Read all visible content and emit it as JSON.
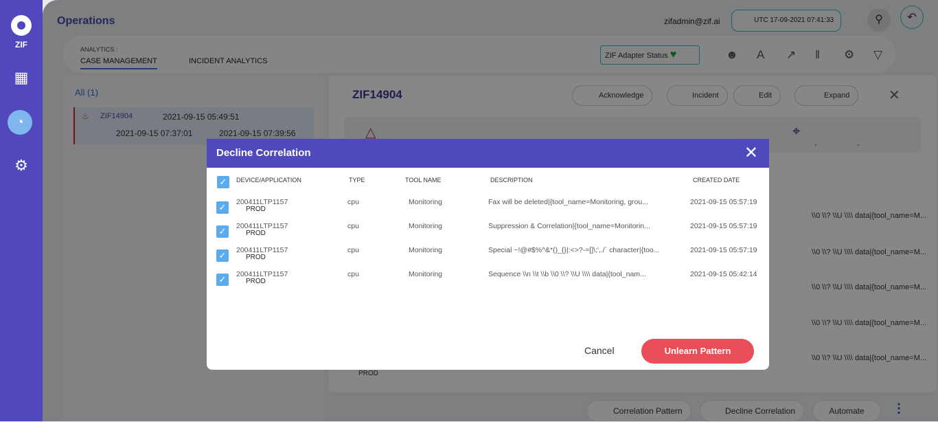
{
  "sidebar": {
    "logo_text": "ZIF"
  },
  "header": {
    "title": "Operations",
    "user": "zifadmin@zif.ai",
    "time": "UTC 17-09-2021 07:41:33 -0000"
  },
  "analytics": {
    "label": "ANALYTICS :",
    "tabs": [
      "CASE MANAGEMENT",
      "INCIDENT ANALYTICS"
    ],
    "adapter_status": "ZIF Adapter Status"
  },
  "list": {
    "filter": "All (1)",
    "card": {
      "id": "ZIF14904",
      "created": "2021-09-15 05:49:51",
      "start": "2021-09-15 07:37:01",
      "end": "2021-09-15 07:39:56"
    }
  },
  "detail": {
    "id": "ZIF14904",
    "buttons": [
      "Acknowledge",
      "Incident",
      "Edit",
      "Expand"
    ],
    "strip_values": [
      "-",
      "-"
    ],
    "bg_desc": "\\\\0 \\\\? \\\\U \\\\\\\\ data|{tool_name=M...",
    "bottom_buttons": [
      "Correlation Pattern",
      "Decline Correlation",
      "Automate"
    ],
    "partial_prod": "PROD"
  },
  "modal": {
    "title": "Decline Correlation",
    "columns": [
      "DEVICE/APPLICATION",
      "TYPE",
      "TOOL NAME",
      "DESCRIPTION",
      "CREATED DATE"
    ],
    "rows": [
      {
        "device": "200411LTP1157",
        "app": "PROD",
        "type": "cpu",
        "tool": "Monitoring",
        "desc": "Fax will be deleted|{tool_name=Monitoring, grou...",
        "date": "2021-09-15 05:57:19"
      },
      {
        "device": "200411LTP1157",
        "app": "PROD",
        "type": "cpu",
        "tool": "Monitoring",
        "desc": "Suppression & Correlation|{tool_name=Monitorin...",
        "date": "2021-09-15 05:57:19"
      },
      {
        "device": "200411LTP1157",
        "app": "PROD",
        "type": "cpu",
        "tool": "Monitoring",
        "desc": "Special ~!@#$%^&*()_{}|:<>?-=[]\\;',./` character|{too...",
        "date": "2021-09-15 05:57:19"
      },
      {
        "device": "200411LTP1157",
        "app": "PROD",
        "type": "cpu",
        "tool": "Monitoring",
        "desc": "Sequence \\\\n \\\\t \\\\b \\\\0 \\\\? \\\\U \\\\\\\\ data|{tool_nam...",
        "date": "2021-09-15 05:42:14"
      }
    ],
    "cancel": "Cancel",
    "confirm": "Unlearn Pattern"
  },
  "colors": {
    "primary": "#5049bd",
    "danger": "#e94d57",
    "checkbox": "#5aacee"
  }
}
